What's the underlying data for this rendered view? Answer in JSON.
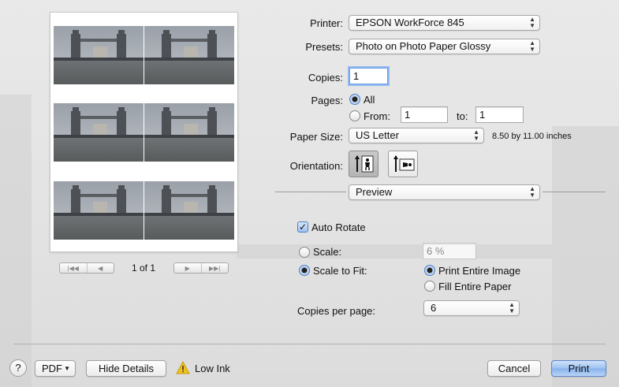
{
  "printer": {
    "label": "Printer:",
    "value": "EPSON WorkForce 845"
  },
  "presets": {
    "label": "Presets:",
    "value": "Photo on Photo Paper Glossy"
  },
  "copies": {
    "label": "Copies:",
    "value": "1"
  },
  "pages": {
    "label": "Pages:",
    "all_label": "All",
    "from_label": "From:",
    "from_value": "1",
    "to_label": "to:",
    "to_value": "1"
  },
  "paper_size": {
    "label": "Paper Size:",
    "value": "US Letter",
    "dimensions": "8.50 by 11.00 inches"
  },
  "orientation": {
    "label": "Orientation:",
    "selected": "portrait"
  },
  "section_popup": {
    "value": "Preview"
  },
  "auto_rotate": {
    "label": "Auto Rotate",
    "checked": true
  },
  "scale": {
    "label": "Scale:",
    "value": "6 %"
  },
  "scale_to_fit": {
    "label": "Scale to Fit:",
    "print_entire_image": "Print Entire Image",
    "fill_entire_paper": "Fill Entire Paper"
  },
  "copies_per_page": {
    "label": "Copies per page:",
    "value": "6"
  },
  "preview": {
    "page_count": "1 of 1",
    "thumbnail_count": 6
  },
  "footer": {
    "help": "?",
    "pdf": "PDF",
    "hide_details": "Hide Details",
    "warning": "Low Ink",
    "cancel": "Cancel",
    "print": "Print"
  },
  "colors": {
    "accent": "#4d7fc8",
    "warning": "#f2c21b"
  }
}
